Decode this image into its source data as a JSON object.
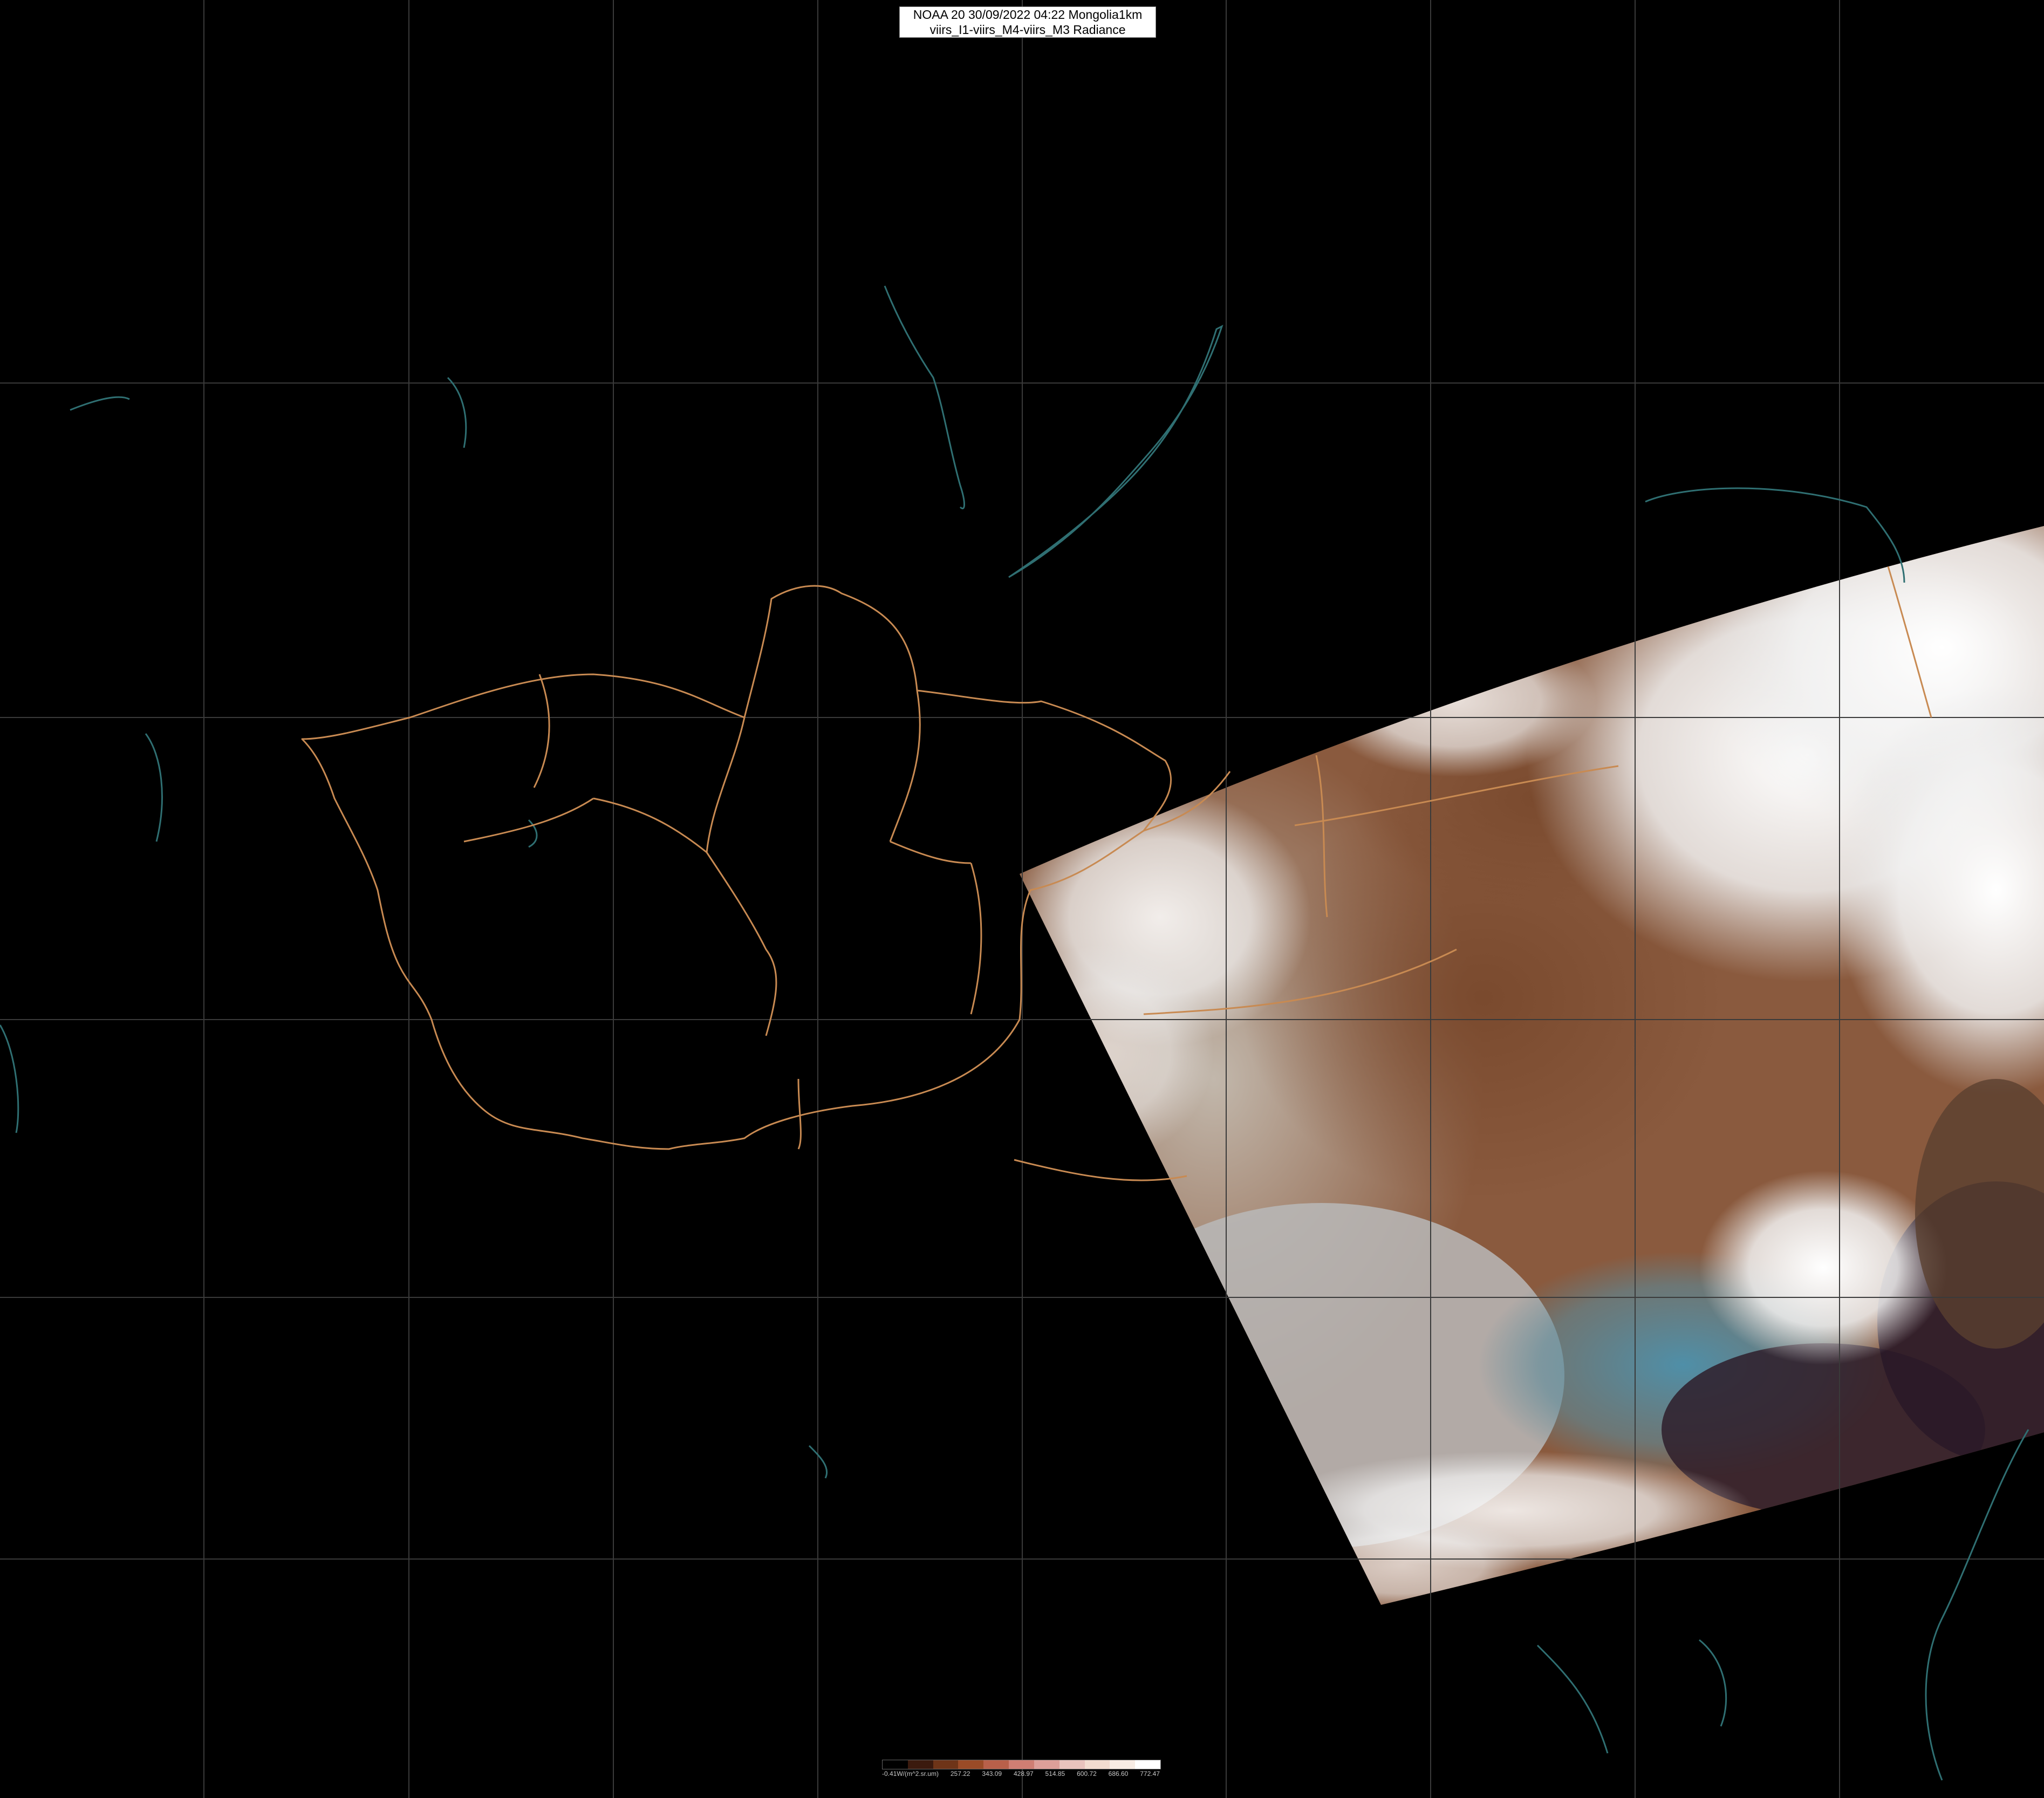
{
  "title": {
    "line1": "NOAA 20 30/09/2022 04:22 Mongolia1km",
    "line2": "viirs_I1-viirs_M4-viirs_M3 Radiance"
  },
  "colors": {
    "background": "#000000",
    "graticule": "#3a3a3a",
    "borders": "#c88a52",
    "coastline": "#2f6f72"
  },
  "legend": {
    "colors": [
      "#000000",
      "#3b1a0e",
      "#6e3418",
      "#9a4b27",
      "#b8604a",
      "#cf7e73",
      "#dd9f99",
      "#e8c3bd",
      "#f2dcd0",
      "#f7ece4",
      "#ffffff"
    ],
    "labels": [
      "-0.41W/(m^2.sr.um)",
      "257.22",
      "343.09",
      "428.97",
      "514.85",
      "600.72",
      "686.60",
      "772.47"
    ]
  }
}
